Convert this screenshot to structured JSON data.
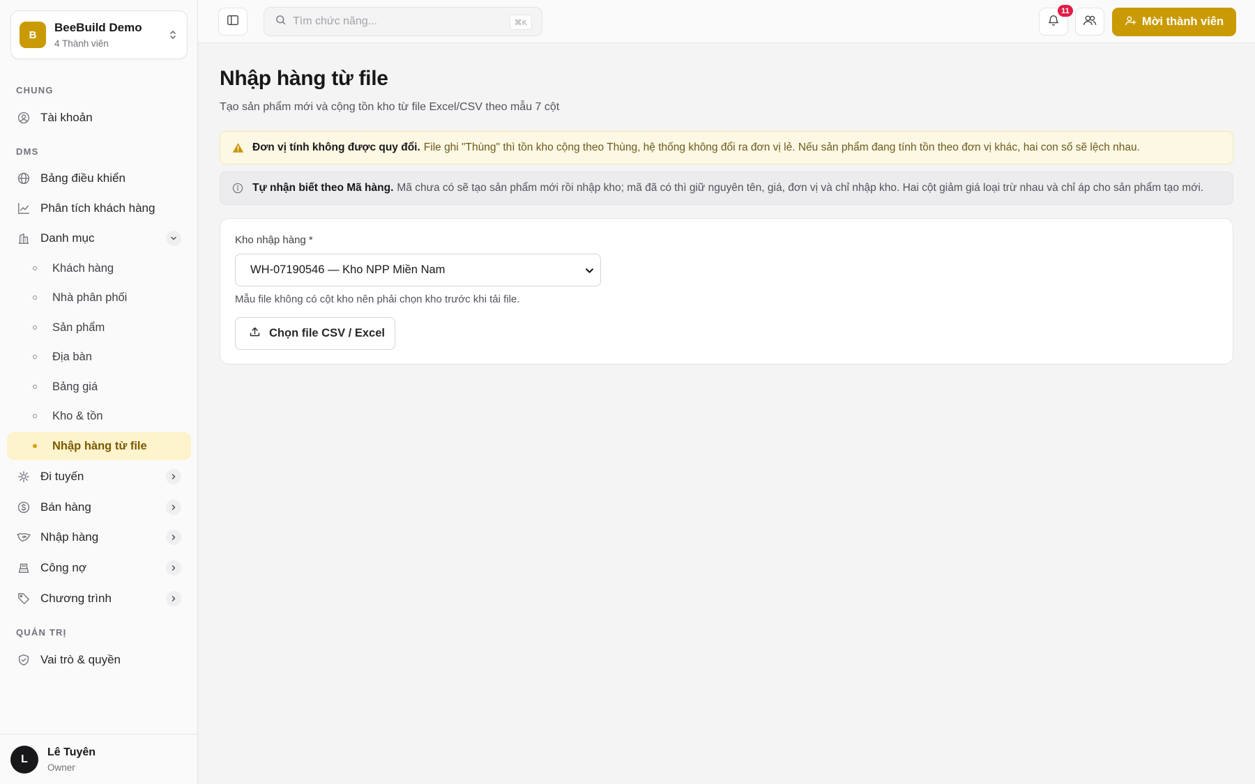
{
  "workspace": {
    "initial": "B",
    "name": "BeeBuild Demo",
    "members": "4 Thành viên"
  },
  "sidebar": {
    "section_general": "CHUNG",
    "account": "Tài khoản",
    "section_dms": "DMS",
    "dashboard": "Bảng điều khiển",
    "customer_analysis": "Phân tích khách hàng",
    "catalog": "Danh mục",
    "catalog_items": [
      "Khách hàng",
      "Nhà phân phối",
      "Sản phẩm",
      "Địa bàn",
      "Bảng giá",
      "Kho & tồn",
      "Nhập hàng từ file"
    ],
    "routing": "Đi tuyến",
    "sales": "Bán hàng",
    "purchasing": "Nhập hàng",
    "debt": "Công nợ",
    "programs": "Chương trình",
    "section_admin": "QUẢN TRỊ",
    "roles": "Vai trò & quyền"
  },
  "user": {
    "initial": "L",
    "name": "Lê Tuyên",
    "role": "Owner"
  },
  "topbar": {
    "search_placeholder": "Tìm chức năng...",
    "search_shortcut": "⌘K",
    "notification_count": "11",
    "invite_label": "Mời thành viên"
  },
  "main": {
    "title": "Nhập hàng từ file",
    "subtitle": "Tạo sản phẩm mới và cộng tồn kho từ file Excel/CSV theo mẫu 7 cột",
    "warning_strong": "Đơn vị tính không được quy đổi.",
    "warning_text": "File ghi \"Thùng\" thì tồn kho cộng theo Thùng, hệ thống không đổi ra đơn vị lẻ. Nếu sản phẩm đang tính tồn theo đơn vị khác, hai con số sẽ lệch nhau.",
    "info_strong": "Tự nhận biết theo Mã hàng.",
    "info_text": "Mã chưa có sẽ tạo sản phẩm mới rồi nhập kho; mã đã có thì giữ nguyên tên, giá, đơn vị và chỉ nhập kho. Hai cột giảm giá loại trừ nhau và chỉ áp cho sản phẩm tạo mới.",
    "warehouse_label": "Kho nhập hàng *",
    "warehouse_selected": "WH-07190546 — Kho NPP Miền Nam",
    "hint": "Mẫu file không có cột kho nên phải chọn kho trước khi tải file.",
    "upload_label": "Chọn file CSV / Excel"
  },
  "colors": {
    "accent": "#ca9a04",
    "badge": "#e11d48",
    "warning_bg": "#fdf8e4"
  }
}
